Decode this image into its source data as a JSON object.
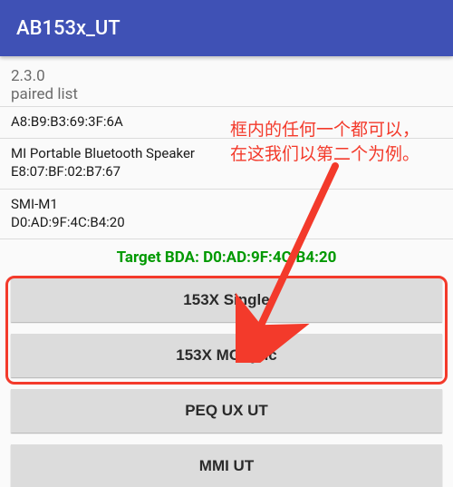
{
  "appbar": {
    "title": "AB153x_UT"
  },
  "version": "2.3.0",
  "paired_label": "paired list",
  "devices": [
    {
      "name": "A8:B9:B3:69:3F:6A",
      "mac": ""
    },
    {
      "name": "MI Portable Bluetooth Speaker",
      "mac": "E8:07:BF:02:B7:67"
    },
    {
      "name": "SMI-M1",
      "mac": "D0:AD:9F:4C:B4:20"
    }
  ],
  "target_label": "Target BDA: D0:AD:9F:4C:B4:20",
  "buttons": {
    "single": "153X Single",
    "mcsync": "153X MCSync",
    "peq": "PEQ UX UT",
    "mmi": "MMI UT"
  },
  "annotation": {
    "line1": "框内的任何一个都可以，",
    "line2": "在这我们以第二个为例。"
  }
}
